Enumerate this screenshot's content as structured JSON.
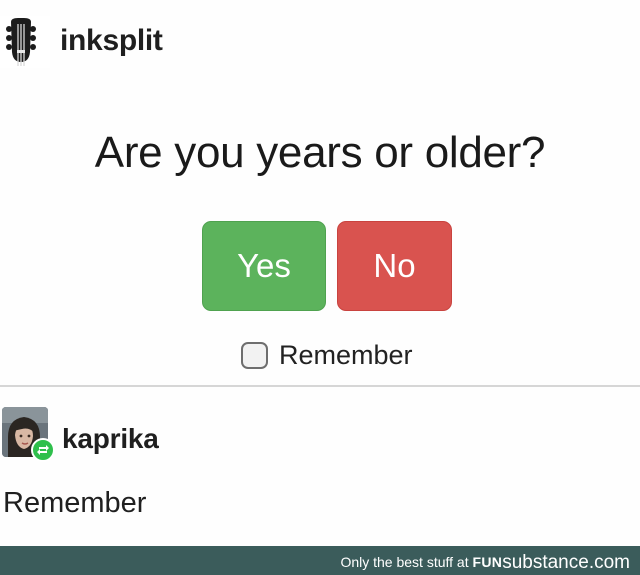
{
  "post": {
    "username": "inksplit",
    "avatar_icon": "guitar-headstock-icon",
    "question": "Are you years or older?",
    "yes_label": "Yes",
    "no_label": "No",
    "remember_label": "Remember",
    "remember_checked": false,
    "colors": {
      "yes": "#5cb35c",
      "no": "#d9534f"
    }
  },
  "reply": {
    "username": "kaprika",
    "avatar_icon": "user-avatar-icon",
    "badge_icon": "reblog-icon",
    "badge_color": "#2fbf4c",
    "text": "Remember"
  },
  "footer": {
    "prefix": "Only the best stuff at",
    "brand_part1": "FUN",
    "brand_part2": "substance",
    "brand_suffix": ".com",
    "background": "#3b5c5b"
  }
}
